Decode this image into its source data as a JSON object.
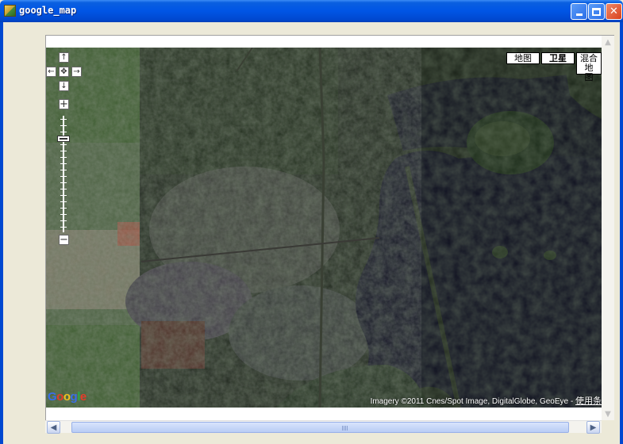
{
  "window": {
    "title": "google_map",
    "icon": "map-app-icon",
    "controls": {
      "minimize": "minimize-icon",
      "maximize": "maximize-icon",
      "close": "✕"
    }
  },
  "map": {
    "map_types": {
      "road": "地图",
      "satellite": "卫星",
      "hybrid_line1": "混合地",
      "hybrid_line2": "图"
    },
    "selected_type": "satellite",
    "pan_controls": {
      "up": "↑",
      "down": "↓",
      "left": "←",
      "right": "→",
      "center": "✥"
    },
    "zoom": {
      "in": "+",
      "out": "−",
      "level": 0.2
    },
    "logo": {
      "letters": [
        "G",
        "o",
        "o",
        "g",
        "l",
        "e"
      ],
      "colors": [
        "#3a6ee8",
        "#e83a2a",
        "#f0c020",
        "#3a6ee8",
        "#2aa84a",
        "#e83a2a"
      ]
    },
    "attribution": "Imagery ©2011 Cnes/Spot Image, DigitalGlobe, GeoEye - ",
    "terms_link": "使用条"
  },
  "scrollbars": {
    "left_arrow": "◀",
    "right_arrow": "▶",
    "up_arrow": "▲",
    "down_arrow": "▼"
  },
  "colors": {
    "titlebar": "#0055e5",
    "window_bg": "#ece9d8",
    "water": "#0f1020",
    "forest": "#2a3a22",
    "urban": "#5a5a58"
  }
}
